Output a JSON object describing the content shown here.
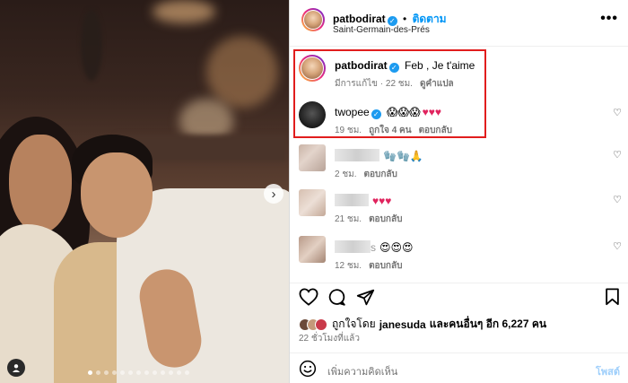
{
  "header": {
    "username": "patbodirat",
    "separator": "•",
    "follow_label": "ติดตาม",
    "location": "Saint-Germain-des-Prés",
    "more": "•••"
  },
  "comments": [
    {
      "user": "patbodirat",
      "text": "Feb , Je t'aime",
      "time": "มีการแก้ไข · 22 ชม.",
      "action1": "ดูคำแปล",
      "action2": ""
    },
    {
      "user": "twopee",
      "emoji": "😱😱😱",
      "hearts": "♥♥♥",
      "time": "19 ชม.",
      "action1": "ถูกใจ 4 คน",
      "action2": "ตอบกลับ"
    },
    {
      "user": "",
      "emoji": "🧤🧤🙏",
      "time": "2 ชม.",
      "action2": "ตอบกลับ"
    },
    {
      "user": "",
      "hearts": "♥♥♥",
      "time": "21 ชม.",
      "action2": "ตอบกลับ"
    },
    {
      "user": "",
      "emoji": "😍😍😍",
      "user_suffix": "s",
      "time": "12 ชม.",
      "action2": "ตอบกลับ"
    }
  ],
  "likes": {
    "text_prefix": "ถูกใจโดย ",
    "liker": "janesuda",
    "text_suffix": " และคนอื่นๆ อีก 6,227 คน"
  },
  "time_ago": "22 ชั่วโมงที่แล้ว",
  "add_comment": {
    "placeholder": "เพิ่มความคิดเห็น",
    "post_label": "โพสต์"
  },
  "colors": {
    "link_blue": "#0095f6",
    "highlight_red": "#e11d1d",
    "verified_blue": "#1d9bf0"
  }
}
